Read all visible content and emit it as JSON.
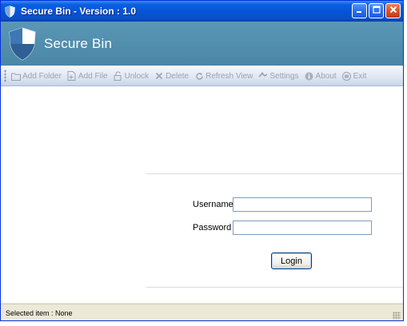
{
  "window": {
    "title": "Secure Bin - Version : 1.0",
    "controls": [
      "minimize",
      "maximize",
      "close"
    ]
  },
  "banner": {
    "app_name": "Secure Bin",
    "logo_icon": "shield-icon"
  },
  "toolbar": {
    "items": [
      {
        "label": "Add Folder",
        "icon": "folder-icon"
      },
      {
        "label": "Add File",
        "icon": "file-icon"
      },
      {
        "label": "Unlock",
        "icon": "unlock-icon"
      },
      {
        "label": "Delete",
        "icon": "delete-icon"
      },
      {
        "label": "Refresh View",
        "icon": "refresh-icon"
      },
      {
        "label": "Settings",
        "icon": "settings-icon"
      },
      {
        "label": "About",
        "icon": "info-icon"
      },
      {
        "label": "Exit",
        "icon": "exit-icon"
      }
    ],
    "enabled": false
  },
  "login": {
    "username_label": "Username",
    "password_label": "Password",
    "username_value": "",
    "password_value": "",
    "button_label": "Login"
  },
  "status": {
    "text": "Selected item : None"
  },
  "colors": {
    "titlebar": "#0553d4",
    "banner": "#4f8aa9",
    "toolbar_text_disabled": "#9aa3b1"
  }
}
